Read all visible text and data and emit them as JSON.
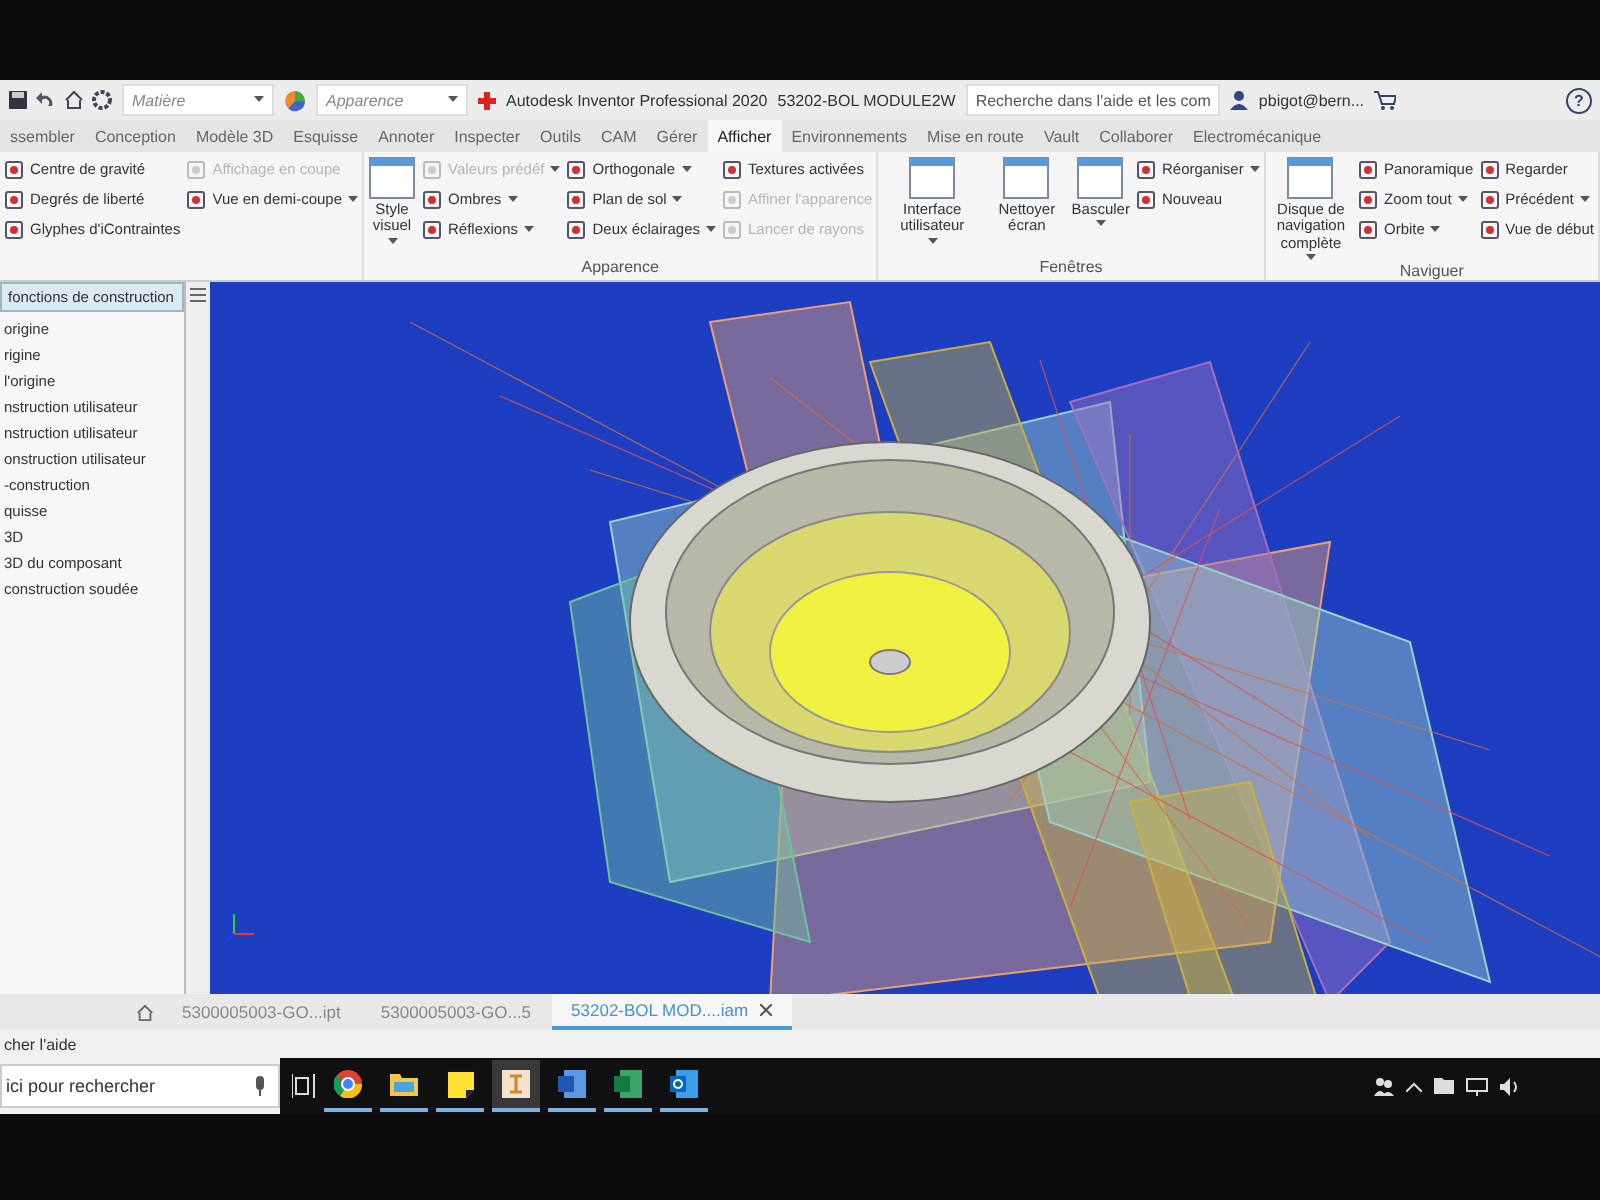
{
  "title_bar": {
    "material": "Matière",
    "appearance": "Apparence",
    "title": "Autodesk Inventor Professional 2020",
    "document": "53202-BOL MODULE2W",
    "search": {
      "placeholder": "Recherche dans l'aide et les com"
    },
    "user": "pbigot@bern...",
    "help": "?"
  },
  "tabs": [
    {
      "label": "ssembler",
      "selected": false
    },
    {
      "label": "Conception",
      "selected": false
    },
    {
      "label": "Modèle 3D",
      "selected": false
    },
    {
      "label": "Esquisse",
      "selected": false
    },
    {
      "label": "Annoter",
      "selected": false
    },
    {
      "label": "Inspecter",
      "selected": false
    },
    {
      "label": "Outils",
      "selected": false
    },
    {
      "label": "CAM",
      "selected": false
    },
    {
      "label": "Gérer",
      "selected": false
    },
    {
      "label": "Afficher",
      "selected": true
    },
    {
      "label": "Environnements",
      "selected": false
    },
    {
      "label": "Mise en route",
      "selected": false
    },
    {
      "label": "Vault",
      "selected": false
    },
    {
      "label": "Collaborer",
      "selected": false
    },
    {
      "label": "Electromécanique",
      "selected": false
    }
  ],
  "ribbon": {
    "panels": [
      {
        "columns": [
          {
            "kind": "stack",
            "items": [
              {
                "label": "Centre de gravité",
                "disabled": false,
                "dropdown": false
              },
              {
                "label": "Degrés de liberté",
                "disabled": false,
                "dropdown": false
              },
              {
                "label": "Glyphes d'iContraintes",
                "disabled": false,
                "dropdown": false
              }
            ]
          },
          {
            "kind": "stack",
            "items": [
              {
                "label": "Affichage en coupe",
                "disabled": true,
                "dropdown": false
              },
              {
                "label": "Vue en demi-coupe",
                "disabled": false,
                "dropdown": true
              }
            ]
          }
        ]
      },
      {
        "label": "Apparence",
        "columns": [
          {
            "kind": "large",
            "items": [
              {
                "label": "Style visuel",
                "disabled": false,
                "dropdown": true
              }
            ]
          },
          {
            "kind": "stack",
            "items": [
              {
                "label": "Valeurs prédéf",
                "disabled": true,
                "dropdown": true
              },
              {
                "label": "Ombres",
                "disabled": false,
                "dropdown": true
              },
              {
                "label": "Réflexions",
                "disabled": false,
                "dropdown": true
              }
            ]
          },
          {
            "kind": "stack",
            "items": [
              {
                "label": "Orthogonale",
                "disabled": false,
                "dropdown": true
              },
              {
                "label": "Plan de sol",
                "disabled": false,
                "dropdown": true
              },
              {
                "label": "Deux éclairages",
                "disabled": false,
                "dropdown": true
              }
            ]
          },
          {
            "kind": "stack",
            "items": [
              {
                "label": "Textures activées",
                "disabled": false,
                "dropdown": false
              },
              {
                "label": "Affiner l'apparence",
                "disabled": true,
                "dropdown": false
              },
              {
                "label": "Lancer de rayons",
                "disabled": true,
                "dropdown": false
              }
            ]
          }
        ]
      },
      {
        "label": "Fenêtres",
        "columns": [
          {
            "kind": "large",
            "items": [
              {
                "label": "Interface utilisateur",
                "disabled": false,
                "dropdown": true
              }
            ]
          },
          {
            "kind": "large",
            "items": [
              {
                "label": "Nettoyer écran",
                "disabled": false,
                "dropdown": false
              }
            ]
          },
          {
            "kind": "large",
            "items": [
              {
                "label": "Basculer",
                "disabled": false,
                "dropdown": true
              }
            ]
          },
          {
            "kind": "stack",
            "items": [
              {
                "label": "Réorganiser",
                "disabled": false,
                "dropdown": true
              },
              {
                "label": "Nouveau",
                "disabled": false,
                "dropdown": false
              }
            ]
          }
        ]
      },
      {
        "label": "Naviguer",
        "columns": [
          {
            "kind": "large",
            "items": [
              {
                "label": "Disque de navigation complète",
                "disabled": false,
                "dropdown": true
              }
            ]
          },
          {
            "kind": "stack",
            "items": [
              {
                "label": "Panoramique",
                "disabled": false,
                "dropdown": false
              },
              {
                "label": "Zoom tout",
                "disabled": false,
                "dropdown": true
              },
              {
                "label": "Orbite",
                "disabled": false,
                "dropdown": true
              }
            ]
          },
          {
            "kind": "stack",
            "items": [
              {
                "label": "Regarder",
                "disabled": false,
                "dropdown": false
              },
              {
                "label": "Précédent",
                "disabled": false,
                "dropdown": true
              },
              {
                "label": "Vue de début",
                "disabled": false,
                "dropdown": false
              }
            ]
          }
        ]
      }
    ]
  },
  "browser": {
    "header": "fonctions de construction",
    "items": [
      "origine",
      "rigine",
      "l'origine",
      "nstruction utilisateur",
      "nstruction utilisateur",
      "onstruction utilisateur",
      "-construction",
      "quisse",
      "3D",
      "3D du composant",
      "construction soudée"
    ]
  },
  "document_tabs": [
    {
      "label": "5300005003-GO...ipt",
      "selected": false
    },
    {
      "label": "5300005003-GO...5",
      "selected": false
    },
    {
      "label": "53202-BOL MOD....iam",
      "selected": true
    }
  ],
  "status_bar": {
    "text": "cher l'aide"
  },
  "taskbar": {
    "search": {
      "placeholder": "ici pour rechercher"
    },
    "apps": [
      {
        "kind": "browser",
        "selected": false
      },
      {
        "kind": "folder",
        "selected": false
      },
      {
        "kind": "notes",
        "selected": false
      },
      {
        "kind": "inventor",
        "selected": true
      },
      {
        "kind": "word",
        "selected": false
      },
      {
        "kind": "excel",
        "selected": false
      },
      {
        "kind": "outlook",
        "selected": false
      }
    ]
  }
}
